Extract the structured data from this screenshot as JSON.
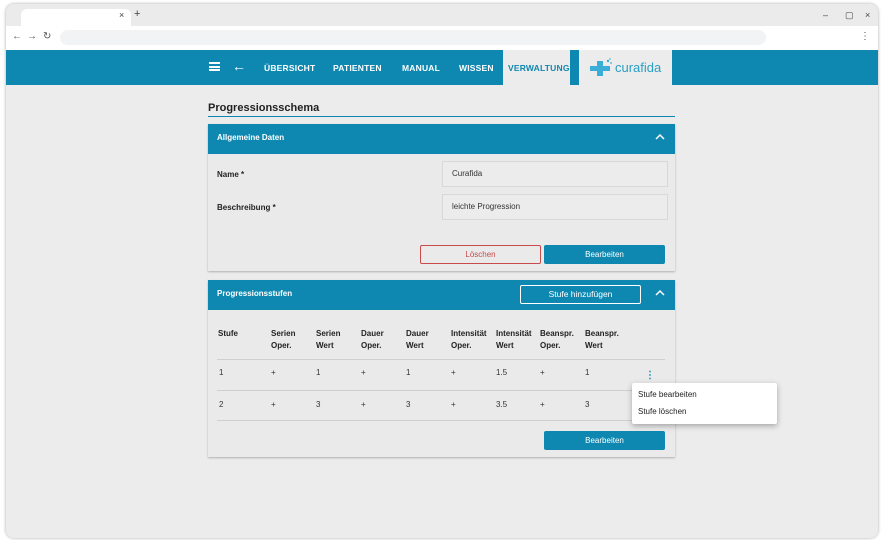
{
  "browser": {
    "tab_close": "×",
    "tab_new": "+",
    "win_min": "–",
    "win_max": "▢",
    "win_close": "×",
    "nav_back": "←",
    "nav_forward": "→",
    "nav_reload": "↻",
    "menu": "⋮"
  },
  "header": {
    "nav": [
      "ÜBERSICHT",
      "PATIENTEN",
      "MANUAL",
      "WISSEN",
      "VERWALTUNG"
    ],
    "active": "VERWALTUNG",
    "logo_text": "curafida",
    "back_icon": "←"
  },
  "page": {
    "title": "Progressionsschema"
  },
  "general": {
    "title": "Allgemeine Daten",
    "name_label": "Name *",
    "name_value": "Curafida",
    "desc_label": "Beschreibung *",
    "desc_value": "leichte Progression",
    "delete_label": "Löschen",
    "edit_label": "Bearbeiten"
  },
  "stages": {
    "title": "Progressionsstufen",
    "add_label": "Stufe hinzufügen",
    "edit_label": "Bearbeiten",
    "columns": [
      [
        "Stufe",
        ""
      ],
      [
        "Serien",
        "Oper."
      ],
      [
        "Serien",
        "Wert"
      ],
      [
        "Dauer",
        "Oper."
      ],
      [
        "Dauer",
        "Wert"
      ],
      [
        "Intensität",
        "Oper."
      ],
      [
        "Intensität",
        "Wert"
      ],
      [
        "Beanspr.",
        "Oper."
      ],
      [
        "Beanspr.",
        "Wert"
      ]
    ],
    "rows": [
      [
        "1",
        "+",
        "1",
        "+",
        "1",
        "+",
        "1.5",
        "+",
        "1"
      ],
      [
        "2",
        "+",
        "3",
        "+",
        "3",
        "+",
        "3.5",
        "+",
        "3"
      ]
    ],
    "kebab": "⋮"
  },
  "context_menu": {
    "items": [
      "Stufe bearbeiten",
      "Stufe löschen"
    ]
  },
  "colors": {
    "primary": "#0e88b0",
    "danger": "#c84a4a"
  }
}
